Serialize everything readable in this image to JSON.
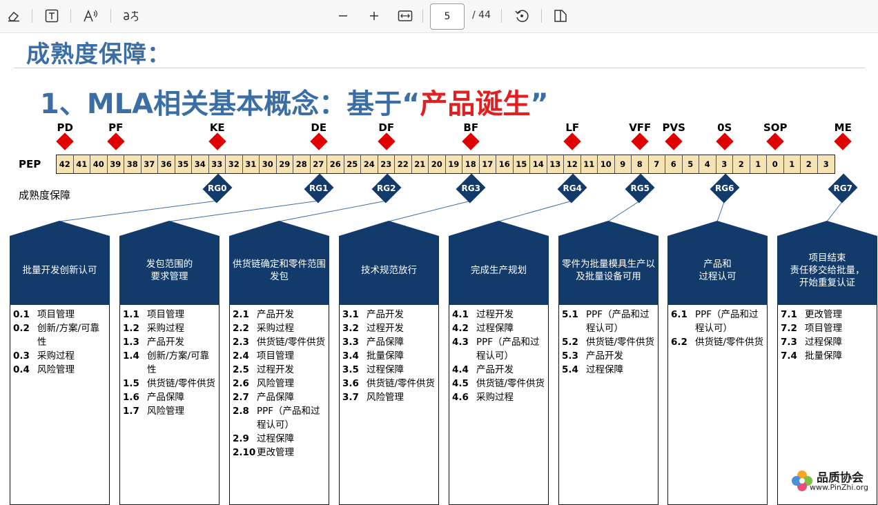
{
  "toolbar": {
    "page_current": "5",
    "page_total": "/ 44",
    "icons": [
      "eraser-icon",
      "text-box-icon",
      "read-aloud-icon",
      "translate-icon",
      "zoom-out-icon",
      "zoom-in-icon",
      "fit-width-icon",
      "rotate-icon",
      "two-page-icon"
    ]
  },
  "doc": {
    "title": "成熟度保障：",
    "subtitle_prefix": "1、MLA相关基本概念：基于",
    "subtitle_quote_open": "“",
    "subtitle_highlight": "产品诞生",
    "subtitle_quote_close": "”",
    "pep_label": "PEP",
    "maturity_label": "成熟度保障",
    "milestones": [
      {
        "label": "PD",
        "cell": 0
      },
      {
        "label": "PF",
        "cell": 3
      },
      {
        "label": "KE",
        "cell": 9
      },
      {
        "label": "DE",
        "cell": 15
      },
      {
        "label": "DF",
        "cell": 19
      },
      {
        "label": "BF",
        "cell": 24
      },
      {
        "label": "LF",
        "cell": 30
      },
      {
        "label": "VFF",
        "cell": 34
      },
      {
        "label": "PVS",
        "cell": 36
      },
      {
        "label": "0S",
        "cell": 39
      },
      {
        "label": "SOP",
        "cell": 42
      },
      {
        "label": "ME",
        "cell": 46
      }
    ],
    "pep_cells": [
      "42",
      "41",
      "40",
      "39",
      "38",
      "37",
      "36",
      "35",
      "34",
      "33",
      "32",
      "31",
      "30",
      "29",
      "28",
      "27",
      "26",
      "25",
      "24",
      "23",
      "22",
      "21",
      "20",
      "19",
      "18",
      "17",
      "16",
      "15",
      "14",
      "13",
      "12",
      "11",
      "10",
      "9",
      "8",
      "7",
      "6",
      "5",
      "4",
      "3",
      "2",
      "1",
      "0",
      "1",
      "2",
      "3"
    ],
    "rg": [
      {
        "label": "RG0",
        "cell": 9,
        "col": 0
      },
      {
        "label": "RG1",
        "cell": 15,
        "col": 1
      },
      {
        "label": "RG2",
        "cell": 19,
        "col": 2
      },
      {
        "label": "RG3",
        "cell": 24,
        "col": 3
      },
      {
        "label": "RG4",
        "cell": 30,
        "col": 4
      },
      {
        "label": "RG5",
        "cell": 34,
        "col": 5
      },
      {
        "label": "RG6",
        "cell": 39,
        "col": 6
      },
      {
        "label": "RG7",
        "cell": 46,
        "col": 7
      }
    ],
    "columns": [
      {
        "title": "批量开发创新认可",
        "items": [
          [
            "0.1",
            "项目管理"
          ],
          [
            "0.2",
            "创新/方案/可靠性"
          ],
          [
            "0.3",
            "采购过程"
          ],
          [
            "0.4",
            "风险管理"
          ]
        ]
      },
      {
        "title": "发包范围的\n要求管理",
        "items": [
          [
            "1.1",
            "项目管理"
          ],
          [
            "1.2",
            "采购过程"
          ],
          [
            "1.3",
            "产品开发"
          ],
          [
            "1.4",
            "创新/方案/可靠性"
          ],
          [
            "1.5",
            "供货链/零件供货"
          ],
          [
            "1.6",
            "产品保障"
          ],
          [
            "1.7",
            "风险管理"
          ]
        ]
      },
      {
        "title": "供货链确定和零件范围发包",
        "items": [
          [
            "2.1",
            "产品开发"
          ],
          [
            "2.2",
            "采购过程"
          ],
          [
            "2.3",
            "供货链/零件供货"
          ],
          [
            "2.4",
            "项目管理"
          ],
          [
            "2.5",
            "过程开发"
          ],
          [
            "2.6",
            "风险管理"
          ],
          [
            "2.7",
            "产品保障"
          ],
          [
            "2.8",
            "PPF（产品和过程认可）"
          ],
          [
            "2.9",
            "过程保障"
          ],
          [
            "2.10",
            "更改管理"
          ]
        ]
      },
      {
        "title": "技术规范放行",
        "items": [
          [
            "3.1",
            "产品开发"
          ],
          [
            "3.2",
            "过程开发"
          ],
          [
            "3.3",
            "产品保障"
          ],
          [
            "3.4",
            "批量保障"
          ],
          [
            "3.5",
            "过程保障"
          ],
          [
            "3.6",
            "供货链/零件供货"
          ],
          [
            "3.7",
            "风险管理"
          ]
        ]
      },
      {
        "title": "完成生产规划",
        "items": [
          [
            "4.1",
            "过程开发"
          ],
          [
            "4.2",
            "过程保障"
          ],
          [
            "4.3",
            "PPF（产品和过程认可）"
          ],
          [
            "4.4",
            "产品开发"
          ],
          [
            "4.5",
            "供货链/零件供货"
          ],
          [
            "4.6",
            "采购过程"
          ]
        ]
      },
      {
        "title": "零件为批量模具生产以及批量设备可用",
        "items": [
          [
            "5.1",
            "PPF（产品和过程认可）"
          ],
          [
            "5.2",
            "供货链/零件供货"
          ],
          [
            "5.3",
            "产品开发"
          ],
          [
            "5.4",
            "过程保障"
          ]
        ]
      },
      {
        "title": "产品和\n过程认可",
        "items": [
          [
            "6.1",
            "PPF（产品和过程认可）"
          ],
          [
            "6.2",
            "供货链/零件供货"
          ]
        ]
      },
      {
        "title": "项目结束\n责任移交给批量，\n开始重复认证",
        "items": [
          [
            "7.1",
            "更改管理"
          ],
          [
            "7.2",
            "项目管理"
          ],
          [
            "7.3",
            "过程保障"
          ],
          [
            "7.4",
            "批量保障"
          ]
        ]
      }
    ],
    "watermark_name": "品质协会",
    "watermark_url": "www.PinZhi.org"
  },
  "colors": {
    "navy": "#123a6b",
    "title_blue": "#3a6ea5",
    "milestone_red": "#e00000",
    "highlight_red": "#e02020",
    "pep_fill": "#f6e3b4"
  }
}
